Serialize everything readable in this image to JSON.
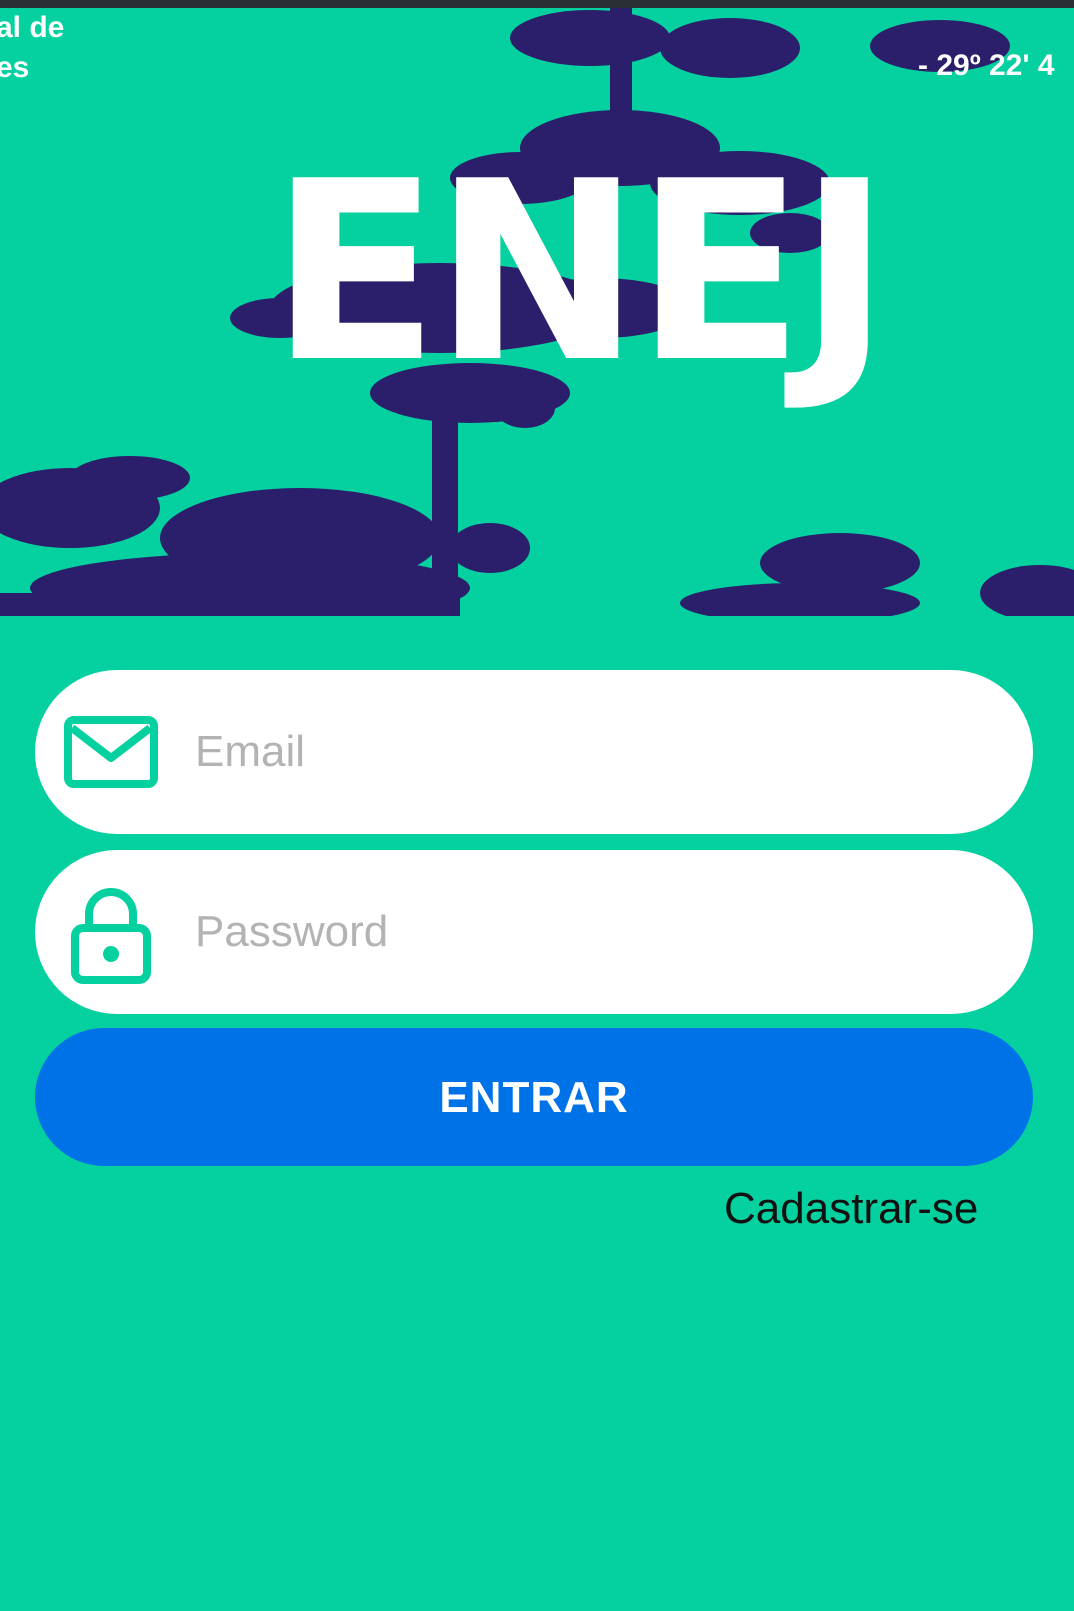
{
  "hero": {
    "logo_text": "ENEJ",
    "corner_text_left": "al de\nes",
    "corner_text_right": "- 29º 22' 4"
  },
  "email_field": {
    "placeholder": "Email",
    "value": "",
    "icon": "mail-icon"
  },
  "password_field": {
    "placeholder": "Password",
    "value": "",
    "icon": "lock-icon"
  },
  "login_button": {
    "label": "ENTRAR"
  },
  "register_link": {
    "label": "Cadastrar-se"
  },
  "colors": {
    "background": "#04d19f",
    "accent": "#0072e8",
    "trees": "#2b1f6b",
    "field": "#ffffff",
    "placeholder": "#b3b3b3"
  }
}
